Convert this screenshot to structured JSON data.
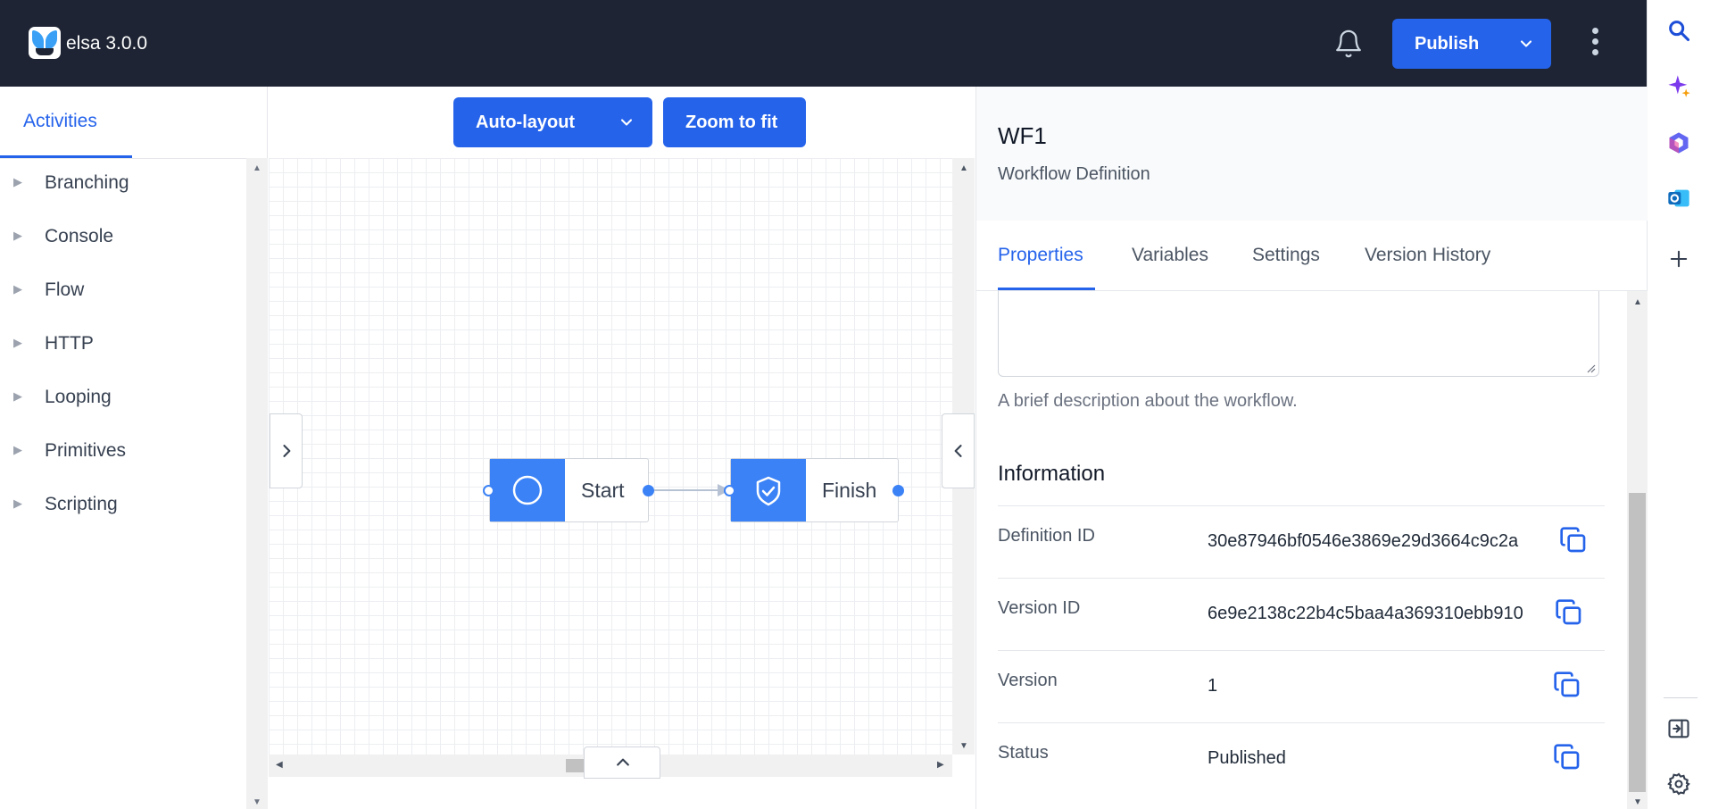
{
  "app": {
    "title": "elsa 3.0.0"
  },
  "header": {
    "publish_label": "Publish"
  },
  "left_panel": {
    "tab_label": "Activities",
    "categories": [
      {
        "label": "Branching"
      },
      {
        "label": "Console"
      },
      {
        "label": "Flow"
      },
      {
        "label": "HTTP"
      },
      {
        "label": "Looping"
      },
      {
        "label": "Primitives"
      },
      {
        "label": "Scripting"
      }
    ]
  },
  "canvas": {
    "auto_layout_label": "Auto-layout",
    "zoom_to_fit_label": "Zoom to fit",
    "nodes": [
      {
        "label": "Start",
        "icon": "circle-icon"
      },
      {
        "label": "Finish",
        "icon": "shield-check-icon"
      }
    ]
  },
  "right_panel": {
    "title": "WF1",
    "subtitle": "Workflow Definition",
    "tabs": [
      {
        "label": "Properties",
        "active": true
      },
      {
        "label": "Variables"
      },
      {
        "label": "Settings"
      },
      {
        "label": "Version History"
      }
    ],
    "description_hint": "A brief description about the workflow.",
    "information_heading": "Information",
    "info_rows": [
      {
        "key": "Definition ID",
        "value": "30e87946bf0546e3869e29d3664c9c2a"
      },
      {
        "key": "Version ID",
        "value": "6e9e2138c22b4c5baa4a369310ebb910"
      },
      {
        "key": "Version",
        "value": "1"
      },
      {
        "key": "Status",
        "value": "Published"
      }
    ]
  },
  "colors": {
    "accent": "#2563eb",
    "node_blue": "#3b82f6",
    "topbar": "#1e2433"
  },
  "side_rail": {
    "icons": [
      "search-icon",
      "copilot-icon",
      "microsoft365-icon",
      "outlook-icon",
      "plus-icon",
      "sidebar-toggle-icon",
      "settings-icon"
    ]
  }
}
